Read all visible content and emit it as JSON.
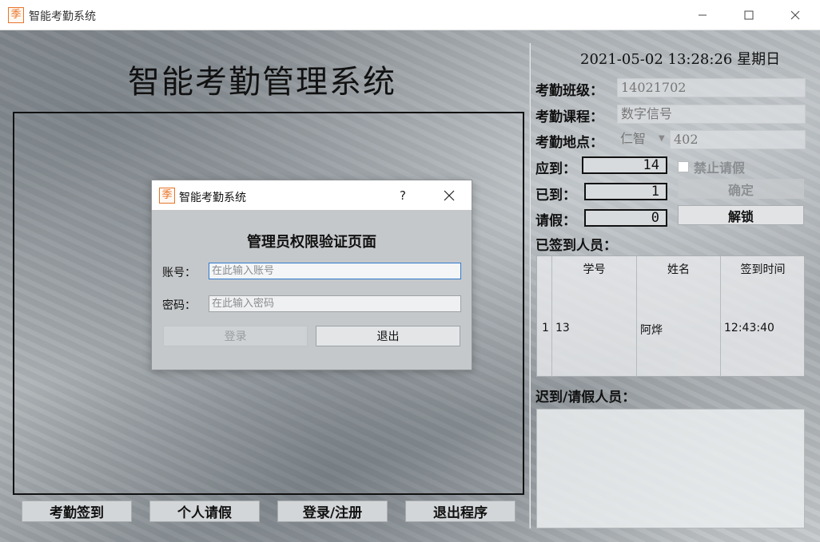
{
  "window": {
    "app_icon_char": "季",
    "title": "智能考勤系统",
    "min_symbol": "—",
    "max_symbol": "☐",
    "close_symbol": "✕"
  },
  "main": {
    "title": "智能考勤管理系统",
    "buttons": {
      "checkin": "考勤签到",
      "leave": "个人请假",
      "login": "登录/注册",
      "exit": "退出程序"
    }
  },
  "side": {
    "datetime": "2021-05-02  13:28:26  星期日",
    "class_label": "考勤班级：",
    "class_value": "14021702",
    "course_label": "考勤课程：",
    "course_value": "数字信号",
    "location_label": "考勤地点：",
    "location_building": "仁智",
    "location_room": "402",
    "expected_label": "应到：",
    "expected_value": "14",
    "arrived_label": "已到：",
    "arrived_value": "1",
    "leave_label": "请假：",
    "leave_value": "0",
    "forbid_leave_label": "禁止请假",
    "confirm_button": "确定",
    "unlock_button": "解锁",
    "signed_label": "已签到人员：",
    "table": {
      "headers": [
        "学号",
        "姓名",
        "签到时间"
      ],
      "rows": [
        {
          "index": "1",
          "id": "13",
          "name": "阿烨",
          "time": "12:43:40"
        }
      ]
    },
    "late_label": "迟到/请假人员："
  },
  "dialog": {
    "icon_char": "季",
    "title": "智能考勤系统",
    "help": "?",
    "heading": "管理员权限验证页面",
    "account_label": "账号：",
    "account_placeholder": "在此输入账号",
    "password_label": "密码：",
    "password_placeholder": "在此输入密码",
    "login_button": "登录",
    "exit_button": "退出"
  },
  "colors": {
    "accent_icon": "#e8742a",
    "focus_border": "#2f7ad1"
  }
}
